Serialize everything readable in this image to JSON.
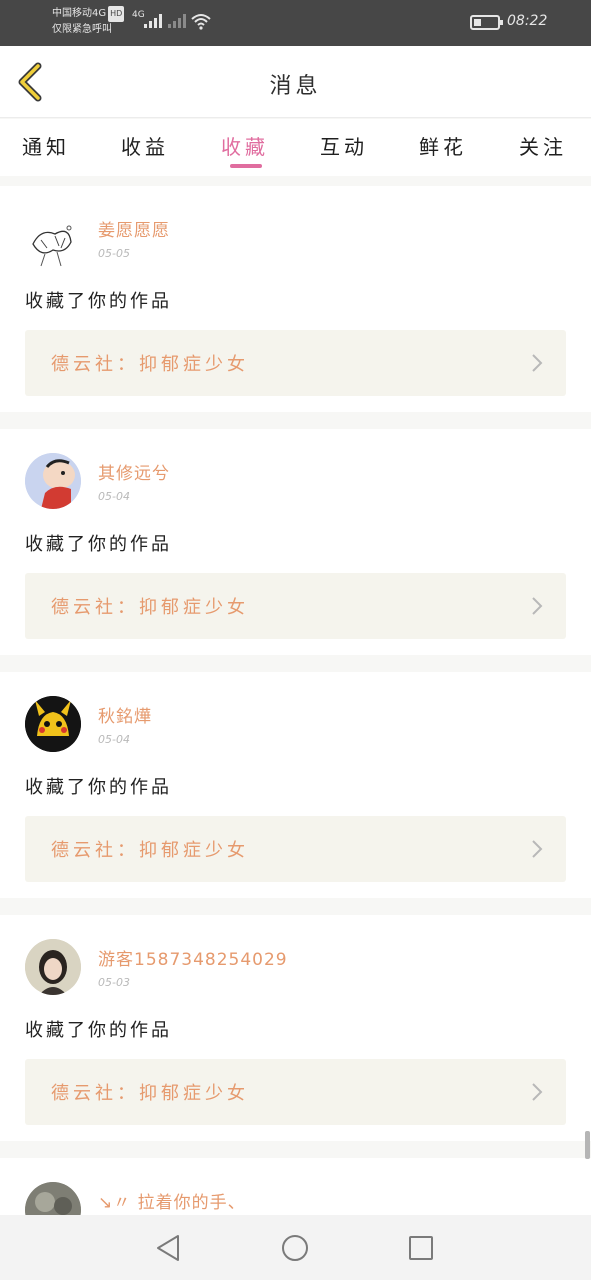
{
  "status_bar": {
    "carrier_line1": "中国移动4G",
    "hd_badge": "HD",
    "carrier_line2": "仅限紧急呼叫",
    "network": "4G",
    "time": "08:22"
  },
  "header": {
    "title": "消息"
  },
  "tabs": [
    {
      "label": "通知",
      "active": false
    },
    {
      "label": "收益",
      "active": false
    },
    {
      "label": "收藏",
      "active": true
    },
    {
      "label": "互动",
      "active": false
    },
    {
      "label": "鲜花",
      "active": false
    },
    {
      "label": "关注",
      "active": false
    }
  ],
  "messages": [
    {
      "username": "姜愿愿愿",
      "date": "05-05",
      "action": "收藏了你的作品",
      "work_title": "德云社：抑郁症少女"
    },
    {
      "username": "其修远兮",
      "date": "05-04",
      "action": "收藏了你的作品",
      "work_title": "德云社：抑郁症少女"
    },
    {
      "username": "秋銘燁",
      "date": "05-04",
      "action": "收藏了你的作品",
      "work_title": "德云社：抑郁症少女"
    },
    {
      "username": "游客1587348254029",
      "date": "05-03",
      "action": "收藏了你的作品",
      "work_title": "德云社：抑郁症少女"
    },
    {
      "username": "↘〃 拉着你的手、"
    }
  ],
  "colors": {
    "accent_pink": "#e06d9f",
    "username_orange": "#e69a6e",
    "work_bg": "#f5f4ed",
    "status_bar_bg": "#474747"
  }
}
